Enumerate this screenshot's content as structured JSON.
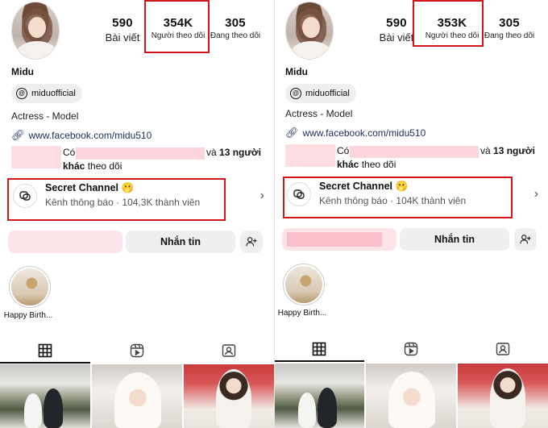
{
  "panels": [
    {
      "username": "Midu",
      "stats": {
        "posts": {
          "value": "590",
          "label": "Bài viết"
        },
        "followers": {
          "value": "354K",
          "label": "Người theo dõi"
        },
        "following": {
          "value": "305",
          "label": "Đang theo dõi"
        }
      },
      "threads_handle": "miduofficial",
      "bio": "Actress - Model",
      "link": "www.facebook.com/midu510",
      "mutual": {
        "prefix": "Có",
        "suffix": "và 13 người",
        "line2": "khác theo dõi"
      },
      "channel": {
        "title": "Secret Channel 🫢",
        "subtitle": "Kênh thông báo · 104,3K thành viên"
      },
      "message_button": "Nhắn tin",
      "highlight": "Happy Birth..."
    },
    {
      "username": "Midu",
      "stats": {
        "posts": {
          "value": "590",
          "label": "Bài viết"
        },
        "followers": {
          "value": "353K",
          "label": "Người theo dõi"
        },
        "following": {
          "value": "305",
          "label": "Đang theo dõi"
        }
      },
      "threads_handle": "miduofficial",
      "bio": "Actress - Model",
      "link": "www.facebook.com/midu510",
      "mutual": {
        "prefix": "Có",
        "suffix": "và 13 người",
        "line2": "khác theo dõi"
      },
      "channel": {
        "title": "Secret Channel 🫢",
        "subtitle": "Kênh thông báo · 104K thành viên"
      },
      "message_button": "Nhắn tin",
      "highlight": "Happy Birth..."
    }
  ],
  "icons": {
    "threads": "threads-icon",
    "link": "link-icon",
    "channel": "broadcast-channel-icon",
    "chevron": "chevron-right-icon",
    "add_user": "add-user-icon",
    "grid": "grid-icon",
    "reels": "reels-icon",
    "tagged": "tagged-icon"
  },
  "colors": {
    "highlight_box": "#d3161b",
    "link": "#1b2d5a"
  }
}
